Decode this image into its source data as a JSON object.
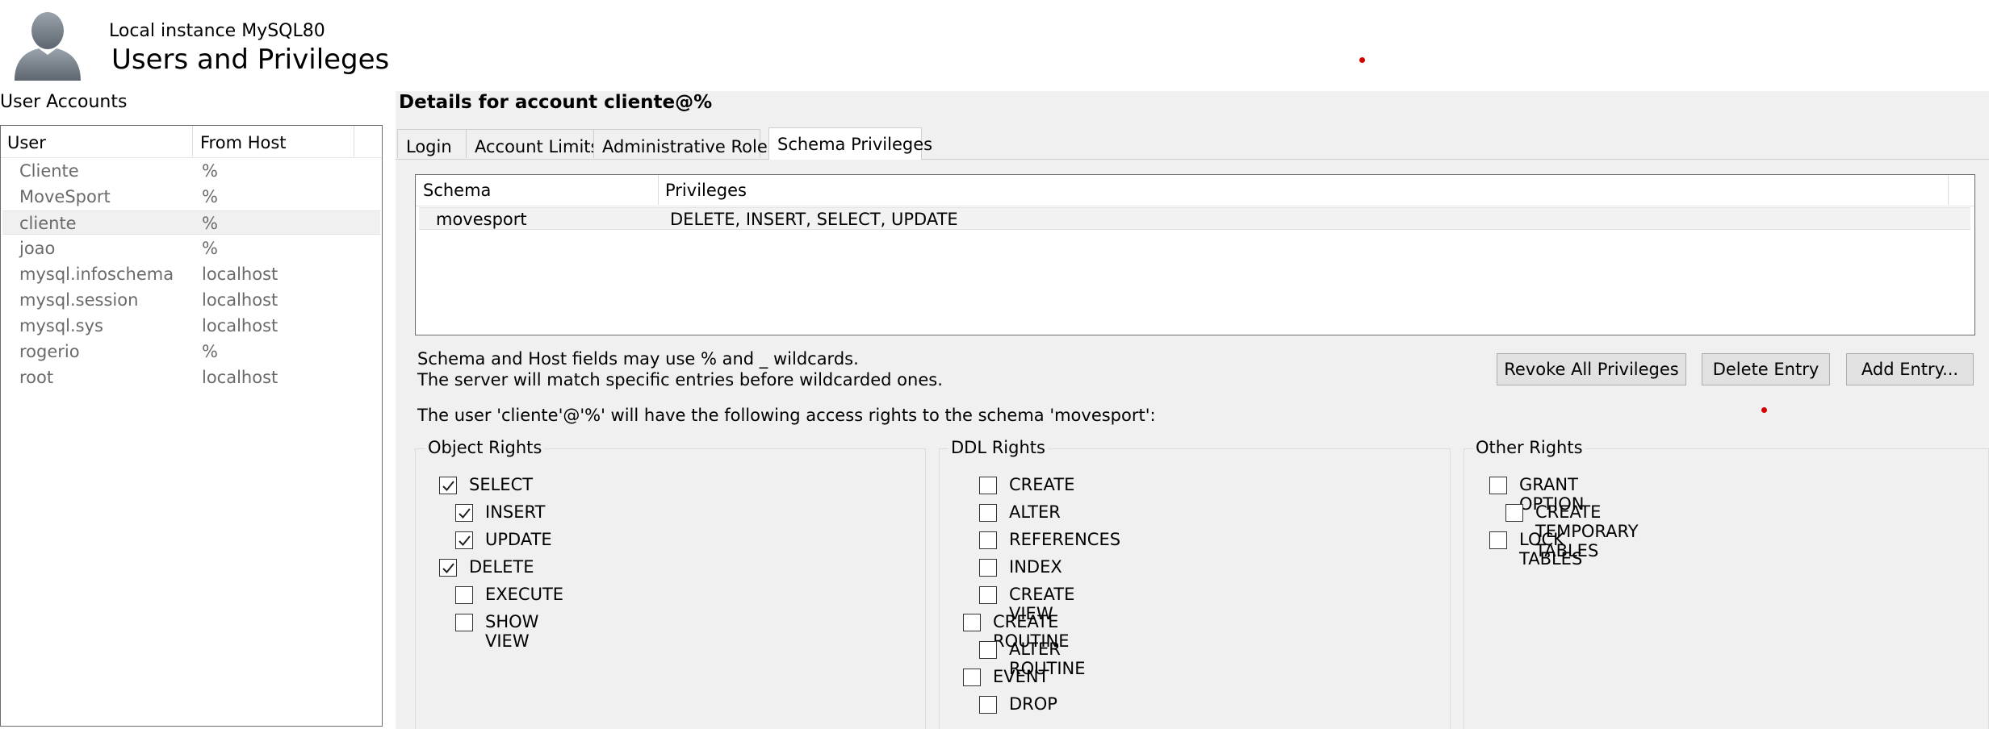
{
  "header": {
    "instance": "Local instance MySQL80",
    "title": "Users and Privileges"
  },
  "user_accounts": {
    "label": "User Accounts",
    "columns": [
      "User",
      "From Host"
    ],
    "rows": [
      {
        "user": "Cliente",
        "host": "%"
      },
      {
        "user": "MoveSport",
        "host": "%"
      },
      {
        "user": "cliente",
        "host": "%"
      },
      {
        "user": "joao",
        "host": "%"
      },
      {
        "user": "mysql.infoschema",
        "host": "localhost"
      },
      {
        "user": "mysql.session",
        "host": "localhost"
      },
      {
        "user": "mysql.sys",
        "host": "localhost"
      },
      {
        "user": "rogerio",
        "host": "%"
      },
      {
        "user": "root",
        "host": "localhost"
      }
    ],
    "selected_index": 2
  },
  "details": {
    "title": "Details for account cliente@%",
    "tabs": [
      "Login",
      "Account Limits",
      "Administrative Roles",
      "Schema Privileges"
    ],
    "active_tab": "Schema Privileges",
    "schema_table": {
      "columns": [
        "Schema",
        "Privileges"
      ],
      "rows": [
        {
          "schema": "movesport",
          "privileges": "DELETE, INSERT, SELECT, UPDATE"
        }
      ]
    },
    "hint_line1": "Schema and Host fields may use % and _ wildcards.",
    "hint_line2": "The server will match specific entries before wildcarded ones.",
    "access_note": "The user 'cliente'@'%' will have the following access rights to the schema 'movesport':",
    "buttons": {
      "revoke": "Revoke All Privileges",
      "delete": "Delete Entry",
      "add": "Add Entry..."
    },
    "object_rights": {
      "label": "Object Rights",
      "items": [
        {
          "label": "SELECT",
          "checked": true
        },
        {
          "label": "INSERT",
          "checked": true
        },
        {
          "label": "UPDATE",
          "checked": true
        },
        {
          "label": "DELETE",
          "checked": true
        },
        {
          "label": "EXECUTE",
          "checked": false
        },
        {
          "label": "SHOW VIEW",
          "checked": false
        }
      ]
    },
    "ddl_rights": {
      "label": "DDL Rights",
      "items": [
        {
          "label": "CREATE",
          "checked": false
        },
        {
          "label": "ALTER",
          "checked": false
        },
        {
          "label": "REFERENCES",
          "checked": false
        },
        {
          "label": "INDEX",
          "checked": false
        },
        {
          "label": "CREATE VIEW",
          "checked": false
        },
        {
          "label": "CREATE ROUTINE",
          "checked": false
        },
        {
          "label": "ALTER ROUTINE",
          "checked": false
        },
        {
          "label": "EVENT",
          "checked": false
        },
        {
          "label": "DROP",
          "checked": false
        }
      ]
    },
    "other_rights": {
      "label": "Other Rights",
      "items": [
        {
          "label": "GRANT OPTION",
          "checked": false
        },
        {
          "label": "CREATE TEMPORARY TABLES",
          "checked": false
        },
        {
          "label": "LOCK TABLES",
          "checked": false
        }
      ]
    }
  }
}
